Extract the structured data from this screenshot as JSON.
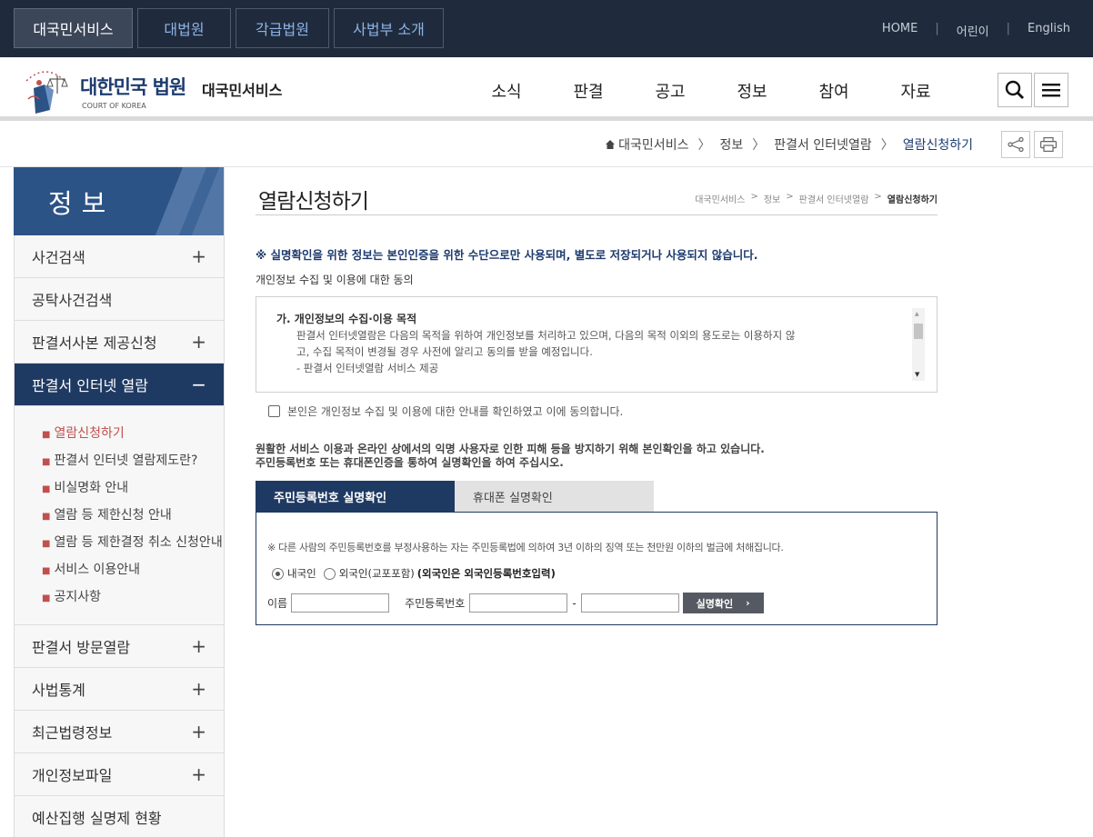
{
  "topbar": {
    "tabs": [
      "대국민서비스",
      "대법원",
      "각급법원",
      "사법부 소개"
    ],
    "active_tab": 0,
    "util": [
      "HOME",
      "어린이",
      "English"
    ]
  },
  "header": {
    "logo_title": "대한민국 법원",
    "logo_sub": "COURT OF KOREA",
    "service_name": "대국민서비스",
    "gnb": [
      "소식",
      "판결",
      "공고",
      "정보",
      "참여",
      "자료"
    ],
    "search_icon": "search-icon",
    "menu_icon": "hamburger-menu-icon"
  },
  "breadcrumb": {
    "items": [
      "대국민서비스",
      "정보",
      "판결서 인터넷열람",
      "열람신청하기"
    ],
    "home_icon": "home-icon"
  },
  "sidebar": {
    "title": "정보",
    "items_top": [
      {
        "label": "사건검색",
        "pm": "+"
      },
      {
        "label": "공탁사건검색",
        "pm": ""
      },
      {
        "label": "판결서사본 제공신청",
        "pm": "+"
      }
    ],
    "active": {
      "label": "판결서 인터넷 열람",
      "pm": "−"
    },
    "sub": [
      "열람신청하기",
      "판결서 인터넷 열람제도란?",
      "비실명화 안내",
      "열람 등 제한신청 안내",
      "열람 등 제한결정 취소 신청안내",
      "서비스 이용안내",
      "공지사항"
    ],
    "items_bottom": [
      {
        "label": "판결서 방문열람",
        "pm": "+"
      },
      {
        "label": "사법통계",
        "pm": "+"
      },
      {
        "label": "최근법령정보",
        "pm": "+"
      },
      {
        "label": "개인정보파일",
        "pm": "+"
      },
      {
        "label": "예산집행 실명제 현황",
        "pm": ""
      }
    ]
  },
  "main": {
    "title": "열람신청하기",
    "crumb": [
      "대국민서비스",
      "정보",
      "판결서 인터넷열람",
      "열람신청하기"
    ],
    "notice": "※ 실명확인을 위한 정보는 본인인증을 위한 수단으로만 사용되며, 별도로 저장되거나 사용되지 않습니다.",
    "consent_title": "개인정보 수집 및 이용에 대한 동의",
    "consent_heading": "가. 개인정보의 수집·이용 목적",
    "consent_body_1": "판결서 인터넷열람은 다음의 목적을 위하여 개인정보를 처리하고 있으며, 다음의 목적 이외의 용도로는 이용하지 않",
    "consent_body_2": "고, 수집 목적이 변경될 경우 사전에 알리고 동의를 받을 예정입니다.",
    "consent_body_3": "- 판결서 인터넷열람 서비스 제공",
    "agree_label": "본인은 개인정보 수집 및 이용에 대한 안내를 확인하였고 이에 동의합니다.",
    "info_1": "원활한 서비스 이용과 온라인 상에서의 익명 사용자로 인한 피해 등을 방지하기 위해 본인확인을 하고 있습니다.",
    "info_2": "주민등록번호 또는 휴대폰인증을 통하여 실명확인을 하여 주십시오.",
    "tabs": [
      "주민등록번호 실명확인",
      "휴대폰 실명확인"
    ],
    "warn": "※ 다른 사람의 주민등록번호를 부정사용하는 자는 주민등록법에 의하여 3년 이하의 징역 또는 천만원 이하의 벌금에 처해집니다.",
    "radio_domestic": "내국인",
    "radio_foreign": "외국인(교포포함)",
    "foreign_note": "(외국인은 외국인등록번호입력)",
    "name_label": "이름",
    "rrn_label": "주민등록번호",
    "dash": "-",
    "name_value": "",
    "rrn_front_value": "",
    "rrn_back_value": "",
    "verify_button": "실명확인",
    "verify_arrow": "›"
  }
}
